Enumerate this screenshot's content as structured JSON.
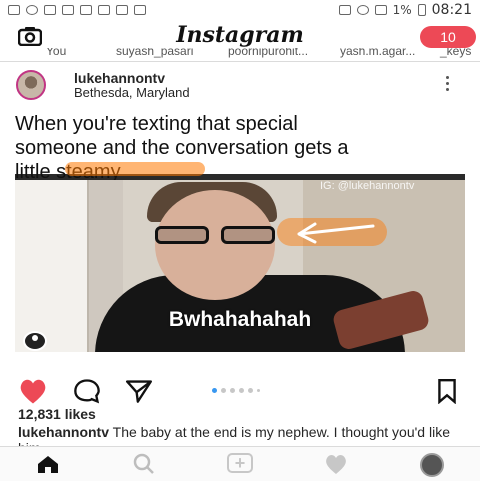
{
  "statusbar": {
    "left_icons": [
      "alert-icon",
      "whatsapp-icon",
      "missed-call-icon",
      "twitter-icon",
      "gallery-icon",
      "messenger-icon",
      "key-icon",
      "close-icon"
    ],
    "battery": "1%",
    "time": "08:21"
  },
  "header": {
    "logo": "Instagram",
    "badge": "10"
  },
  "stories": {
    "items": [
      "You",
      "suyash_pasari",
      "poornipurohit...",
      "yash.m.agar...",
      "_keys"
    ]
  },
  "post": {
    "username": "lukehannontv",
    "location": "Bethesda, Maryland",
    "image": {
      "caption_top_lines": [
        "When you're texting that special",
        "someone and the conversation gets a",
        "little steamy"
      ],
      "handle": "IG: @lukehannontv",
      "meme_text": "Bwhahahahah"
    },
    "likes": "12,831 likes",
    "caption": {
      "user": "lukehannontv",
      "text": "The baby at the end is my nephew. I thought you'd like him"
    }
  },
  "colors": {
    "accent": "#3897f0",
    "badge": "#ed4956",
    "like": "#ed4956"
  },
  "icons": {
    "camera": "camera-icon",
    "more": "more-icon",
    "like": "heart-icon",
    "comment": "comment-icon",
    "share": "send-icon",
    "save": "bookmark-icon"
  },
  "tabs": [
    "home-icon",
    "search-icon",
    "add-icon",
    "heart-icon",
    "profile-icon"
  ]
}
